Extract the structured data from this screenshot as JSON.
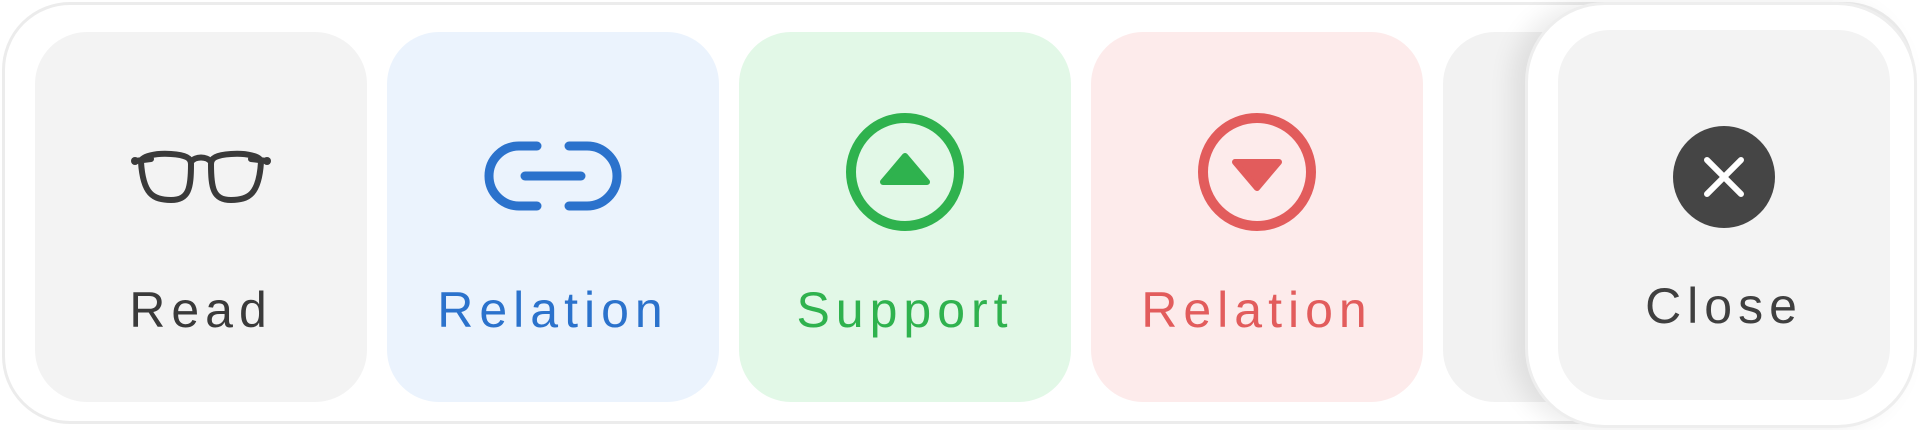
{
  "actions": [
    {
      "id": "read",
      "label": "Read",
      "icon": "glasses-icon",
      "color": "#3a3a3a"
    },
    {
      "id": "relation-link",
      "label": "Relation",
      "icon": "link-icon",
      "color": "#2b72cc"
    },
    {
      "id": "support",
      "label": "Support",
      "icon": "arrow-up-circle-icon",
      "color": "#2fb24e"
    },
    {
      "id": "relation-oppose",
      "label": "Relation",
      "icon": "arrow-down-circle-icon",
      "color": "#e25c5c"
    }
  ],
  "close": {
    "label": "Close",
    "icon": "close-circle-icon",
    "color": "#3f3f3f"
  }
}
